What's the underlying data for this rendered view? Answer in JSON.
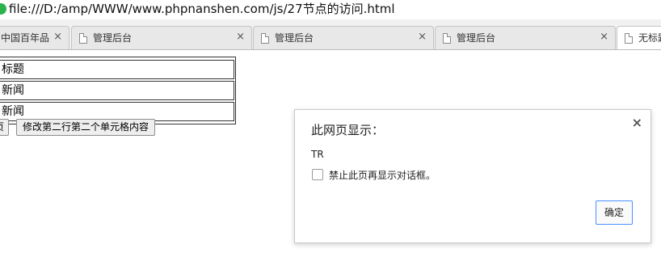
{
  "browser": {
    "url": "file:///D:/amp/WWW/www.phpnanshen.com/js/27节点的访问.html",
    "tabs": [
      {
        "label": "中国百年品",
        "close": "×"
      },
      {
        "label": "管理后台",
        "close": "×"
      },
      {
        "label": "管理后台",
        "close": "×"
      },
      {
        "label": "管理后台",
        "close": "×"
      },
      {
        "label": "无标题",
        "close": ""
      }
    ]
  },
  "page": {
    "rows": [
      "标题",
      "新闻",
      "新闻"
    ],
    "buttons": [
      "页",
      "修改第二行第二个单元格内容"
    ]
  },
  "dialog": {
    "title": "此网页显示：",
    "message": "TR",
    "checkbox_label": "禁止此页再显示对话框。",
    "ok_label": "确定",
    "close": "×"
  },
  "colors": {
    "accent": "#4d90fe",
    "favicon": "#2bb24c"
  }
}
